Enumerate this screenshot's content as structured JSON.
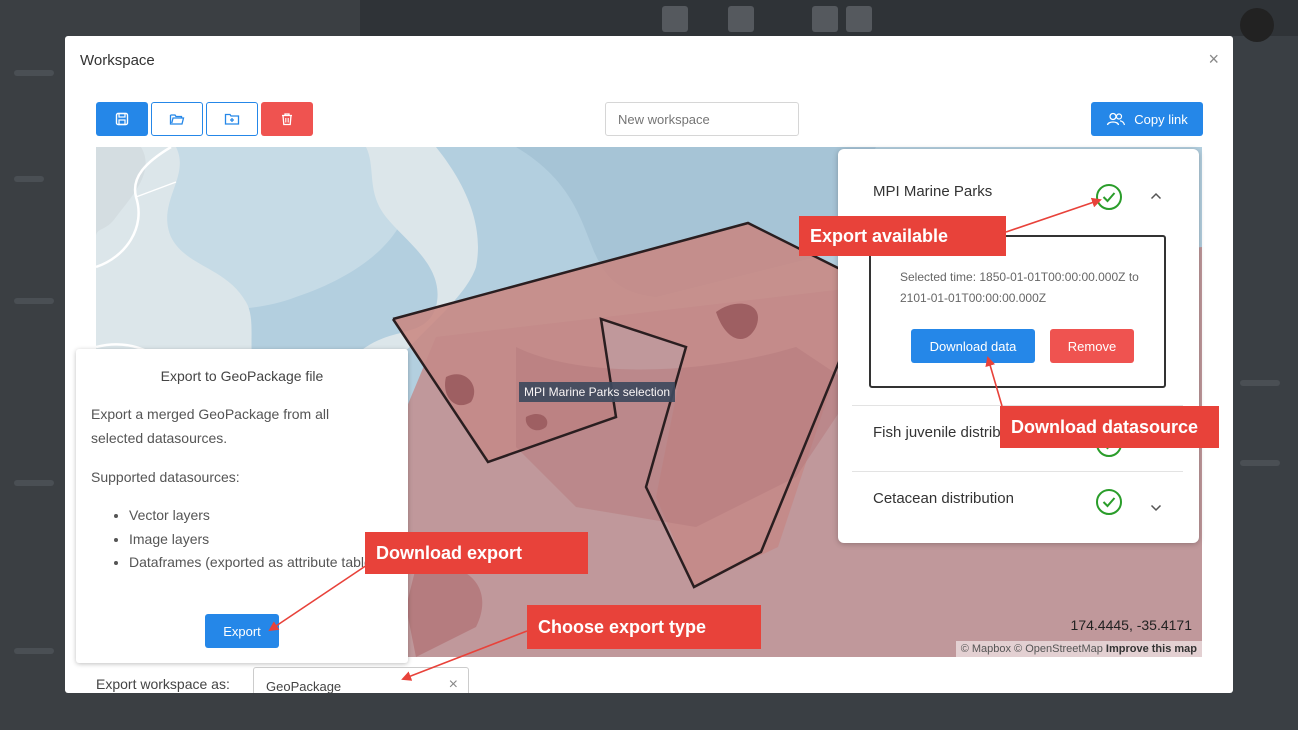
{
  "modal": {
    "title": "Workspace",
    "close_glyph": "×",
    "toolbar": {
      "save_icon": "save-icon",
      "open_icon": "folder-open-icon",
      "new_icon": "folder-add-icon",
      "delete_icon": "trash-icon"
    },
    "workspace_name_placeholder": "New workspace",
    "copy_link_label": "Copy link",
    "copy_link_icon": "users-icon"
  },
  "map": {
    "selection_label": "MPI Marine Parks selection",
    "coordinates": "174.4445, -35.4171",
    "attribution": "© Mapbox © OpenStreetMap",
    "attribution_link": "Improve this map"
  },
  "datasources": [
    {
      "name": "MPI Marine Parks",
      "status_icon": "check-circle-icon",
      "expanded": true,
      "selected_time": "Selected time: 1850-01-01T00:00:00.000Z to 2101-01-01T00:00:00.000Z",
      "download_label": "Download data",
      "remove_label": "Remove"
    },
    {
      "name": "Fish juvenile distribu",
      "status_icon": "check-circle-icon",
      "expanded": false
    },
    {
      "name": "Cetacean distribution",
      "status_icon": "check-circle-icon",
      "expanded": false
    }
  ],
  "export_popover": {
    "title": "Export to GeoPackage file",
    "description": "Export a merged GeoPackage from all selected datasources.",
    "supported_heading": "Supported datasources:",
    "supported": [
      "Vector layers",
      "Image layers",
      "Dataframes (exported as attribute tables)"
    ],
    "export_label": "Export"
  },
  "export_as": {
    "label": "Export workspace as:",
    "value": "GeoPackage",
    "clear_glyph": "×"
  },
  "annotations": {
    "export_available": "Export available",
    "download_datasource": "Download datasource",
    "download_export": "Download export",
    "choose_export_type": "Choose export type"
  },
  "colors": {
    "primary": "#2587e8",
    "danger": "#ef5350",
    "callout": "#e8423a",
    "success": "#2a9d2a"
  }
}
